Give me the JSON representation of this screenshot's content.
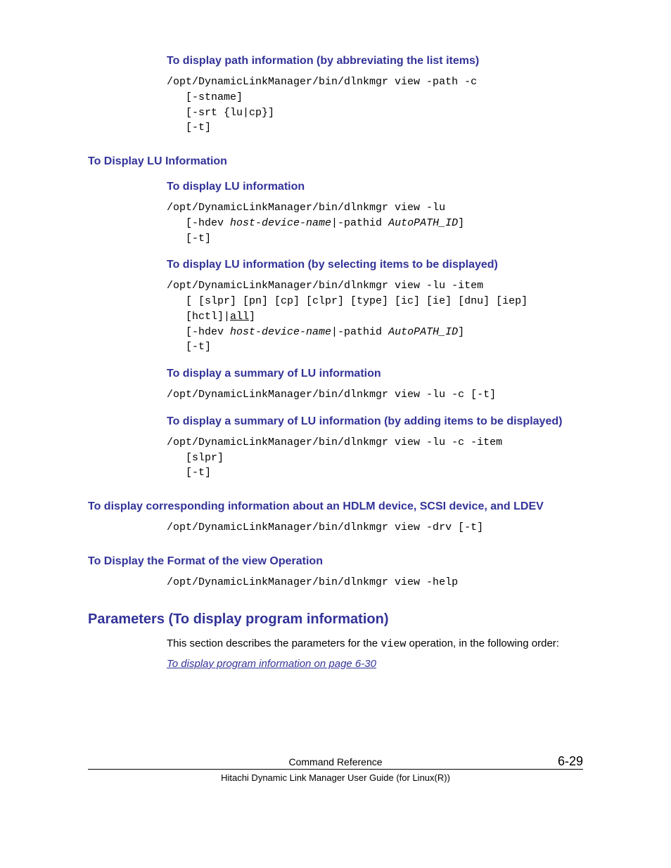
{
  "sections": {
    "abbrev_path": {
      "heading": "To display path information (by abbreviating the list items)",
      "code": "/opt/DynamicLinkManager/bin/dlnkmgr view -path -c\n   [-stname]\n   [-srt {lu|cp}]\n   [-t]"
    },
    "lu_main": {
      "heading": "To Display LU Information"
    },
    "lu_info": {
      "heading": "To display LU information",
      "code_prefix": "/opt/DynamicLinkManager/bin/dlnkmgr view -lu\n   [-hdev ",
      "code_italic1": "host-device-name",
      "code_mid": "|-pathid ",
      "code_italic2": "AutoPATH_ID",
      "code_suffix": "]\n   [-t]"
    },
    "lu_select": {
      "heading": "To display LU information (by selecting items to be displayed)",
      "code_l1": "/opt/DynamicLinkManager/bin/dlnkmgr view -lu -item",
      "code_l2": "   [ [slpr] [pn] [cp] [clpr] [type] [ic] [ie] [dnu] [iep]",
      "code_l3a": "   [hctl]|",
      "code_l3_ul": "all",
      "code_l3b": "]",
      "code_l4a": "   [-hdev ",
      "code_l4_i1": "host-device-name",
      "code_l4b": "|-pathid ",
      "code_l4_i2": "AutoPATH_ID",
      "code_l4c": "]",
      "code_l5": "   [-t]"
    },
    "lu_summary": {
      "heading": "To display a summary of LU information",
      "code": "/opt/DynamicLinkManager/bin/dlnkmgr view -lu -c [-t]"
    },
    "lu_summary_add": {
      "heading": "To display a summary of LU information (by adding items to be displayed)",
      "code": "/opt/DynamicLinkManager/bin/dlnkmgr view -lu -c -item\n   [slpr]\n   [-t]"
    },
    "hdlm": {
      "heading": "To display corresponding information about an HDLM device, SCSI device, and LDEV",
      "code": "/opt/DynamicLinkManager/bin/dlnkmgr view -drv [-t]"
    },
    "format": {
      "heading": "To Display the Format of the view Operation",
      "code": "/opt/DynamicLinkManager/bin/dlnkmgr view -help"
    },
    "params": {
      "heading": "Parameters (To display program information)",
      "body_pre": "This section describes the parameters for the ",
      "body_mono": "view",
      "body_post": " operation, in the following order:",
      "xref": "To display program information on page 6-30"
    }
  },
  "footer": {
    "title": "Command Reference",
    "sub": "Hitachi Dynamic Link Manager User Guide (for Linux(R))",
    "page": "6-29"
  }
}
